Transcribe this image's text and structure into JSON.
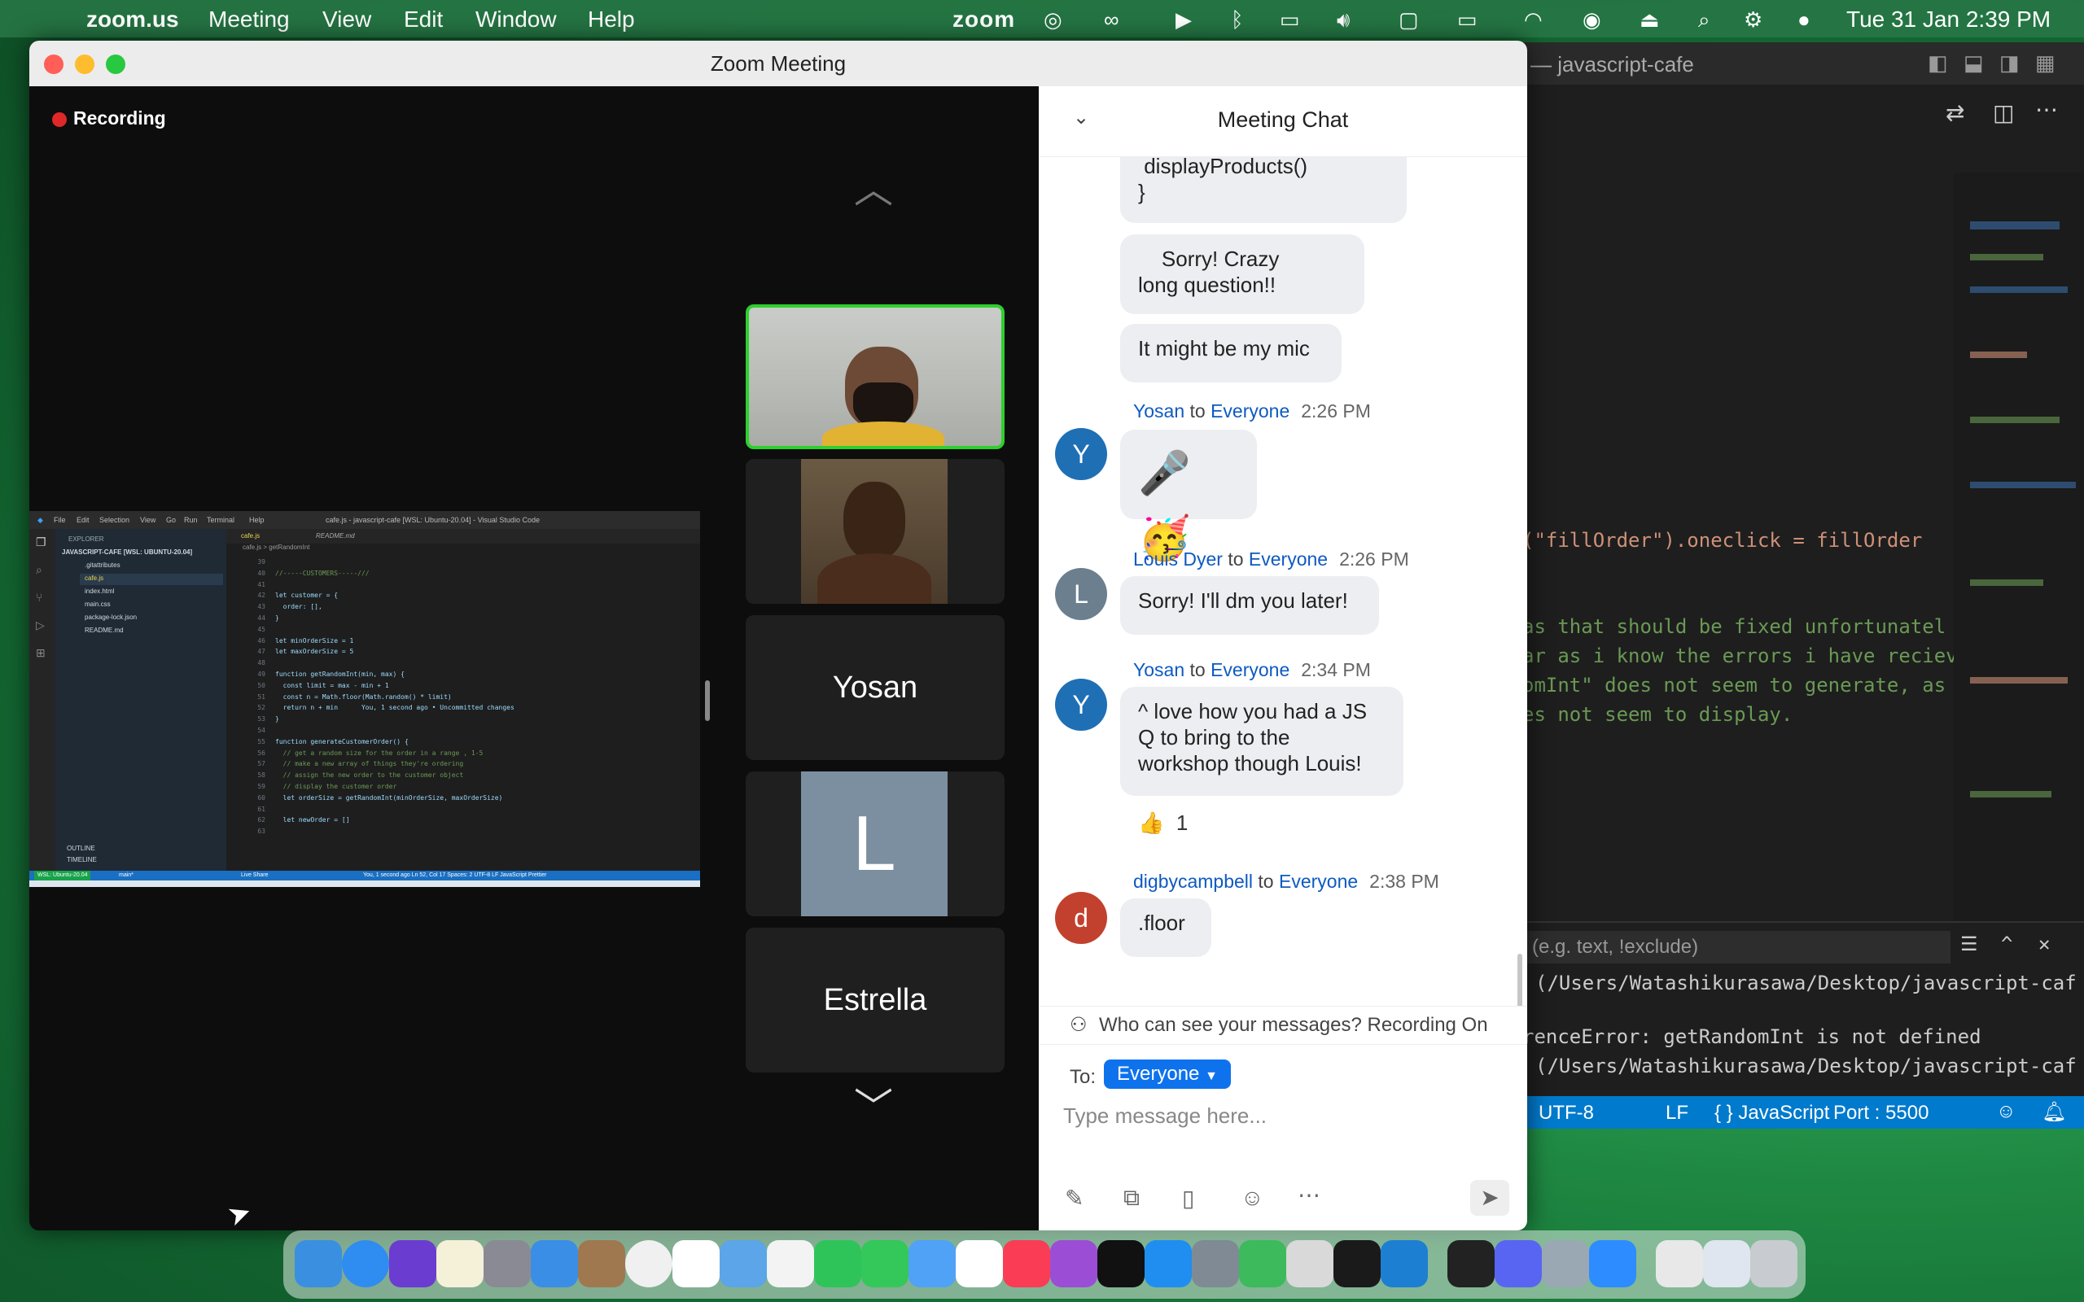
{
  "menubar": {
    "app_name": "zoom.us",
    "items": [
      "Meeting",
      "View",
      "Edit",
      "Window",
      "Help"
    ],
    "status_app": "zoom",
    "datetime": "Tue 31 Jan  2:39 PM"
  },
  "vscode": {
    "title": "— javascript-cafe",
    "code_lines": [
      "(\"fillOrder\").oneclick = fillOrder",
      "",
      "as that should be fixed unfortunatel",
      "ar as i know the errors i have reciev",
      "omInt\" does not seem to generate, as",
      "es not seem to display."
    ],
    "panel_filter_placeholder": "(e.g. text, !exclude)",
    "panel_lines": [
      "(/Users/Watashikurasawa/Desktop/javascript-caf",
      "",
      "renceError: getRandomInt is not defined",
      "(/Users/Watashikurasawa/Desktop/javascript-caf"
    ],
    "status": {
      "encoding": "UTF-8",
      "eol": "LF",
      "language": "{ } JavaScript",
      "port": "Port : 5500"
    }
  },
  "zoom": {
    "title": "Zoom Meeting",
    "recording_label": "Recording",
    "participants": [
      {
        "name": "Yosan",
        "kind": "name"
      },
      {
        "name": "L",
        "kind": "letter"
      },
      {
        "name": "Estrella",
        "kind": "name"
      }
    ],
    "shared_screen": {
      "window_title": "cafe.js - javascript-cafe [WSL: Ubuntu-20.04] - Visual Studio Code",
      "menu": [
        "File",
        "Edit",
        "Selection",
        "View",
        "Go",
        "Run",
        "Terminal",
        "Help"
      ],
      "explorer_header": "EXPLORER",
      "project": "JAVASCRIPT-CAFE [WSL: UBUNTU-20.04]",
      "files": [
        ".gitattributes",
        "cafe.js",
        "index.html",
        "main.css",
        "package-lock.json",
        "README.md"
      ],
      "tabs": [
        "cafe.js",
        "README.md"
      ],
      "breadcrumb": "cafe.js > getRandomInt",
      "line_numbers": [
        "39",
        "40",
        "41",
        "42",
        "43",
        "44",
        "45",
        "46",
        "47",
        "48",
        "49",
        "50",
        "51",
        "52",
        "53",
        "54",
        "55",
        "56",
        "57",
        "58",
        "59",
        "60",
        "61",
        "62",
        "63"
      ],
      "code": [
        "",
        "//-----CUSTOMERS-----///",
        "",
        "let customer = {",
        "  order: [],",
        "}",
        "",
        "let minOrderSize = 1",
        "let maxOrderSize = 5",
        "",
        "function getRandomInt(min, max) {",
        "  const limit = max - min + 1",
        "  const n = Math.floor(Math.random() * limit)",
        "  return n + min      You, 1 second ago • Uncommitted changes",
        "}",
        "",
        "function generateCustomerOrder() {",
        "  // get a random size for the order in a range , 1-5",
        "  // make a new array of things they're ordering",
        "  // assign the new order to the customer object",
        "  // display the customer order",
        "  let orderSize = getRandomInt(minOrderSize, maxOrderSize)",
        "",
        "  let newOrder = []",
        ""
      ],
      "outline": "OUTLINE",
      "timeline": "TIMELINE",
      "status_left": "WSL: Ubuntu-20.04",
      "status_branch": "main*",
      "status_live": "Live Share",
      "status_right": "You, 1 second ago   Ln 52, Col 17   Spaces: 2   UTF-8   LF   JavaScript   Prettier"
    },
    "chat": {
      "header": "Meeting Chat",
      "messages_top": [
        {
          "text": " displayProducts()\n}"
        },
        {
          "text": "    Sorry! Crazy\nlong question!!"
        },
        {
          "text": "It might be my mic"
        }
      ],
      "messages": [
        {
          "avatar": "Y",
          "avatar_color": "#1f6fb5",
          "sender": "Yosan",
          "to_word": "to",
          "recipient": "Everyone",
          "time": "2:26 PM",
          "text": "🎤🥳"
        },
        {
          "avatar": "L",
          "avatar_color": "#6b7f8e",
          "sender": "Louis Dyer",
          "to_word": "to",
          "recipient": "Everyone",
          "time": "2:26 PM",
          "text": "Sorry! I'll dm you later!"
        },
        {
          "avatar": "Y",
          "avatar_color": "#1f6fb5",
          "sender": "Yosan",
          "to_word": "to",
          "recipient": "Everyone",
          "time": "2:34 PM",
          "text": "^ love how you had a JS\nQ to bring to the\nworkshop though Louis!"
        },
        {
          "avatar": "d",
          "avatar_color": "#c2412e",
          "sender": "digbycampbell",
          "to_word": "to",
          "recipient": "Everyone",
          "time": "2:38 PM",
          "text": ".floor"
        }
      ],
      "reaction": {
        "emoji": "👍",
        "count": "1"
      },
      "privacy_notice": "Who can see your messages? Recording On",
      "to_label": "To:",
      "to_value": "Everyone",
      "input_placeholder": "Type message here..."
    }
  }
}
